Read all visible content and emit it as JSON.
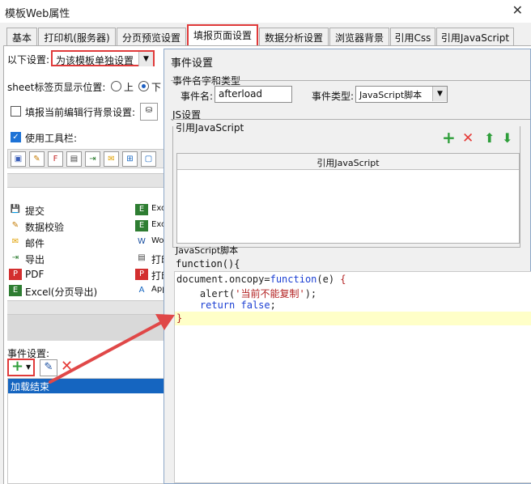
{
  "window": {
    "title": "模板Web属性",
    "close": "✕"
  },
  "tabs": [
    {
      "label": "基本"
    },
    {
      "label": "打印机(服务器)"
    },
    {
      "label": "分页预览设置"
    },
    {
      "label": "填报页面设置"
    },
    {
      "label": "数据分析设置"
    },
    {
      "label": "浏览器背景"
    },
    {
      "label": "引用Css"
    },
    {
      "label": "引用JavaScript"
    }
  ],
  "settings": {
    "mode_label": "以下设置:",
    "mode_value": "为该模板单独设置",
    "sheet_position_label": "sheet标签页显示位置:",
    "pos_top": "上",
    "pos_bottom": "下",
    "fill_bg_label": "填报当前编辑行背景设置:",
    "use_toolbar_label": "使用工具栏:"
  },
  "toolbar_list_left": [
    {
      "icon": "submit-icon",
      "label": "提交",
      "glyph": "💾"
    },
    {
      "icon": "verify-icon",
      "label": "数据校验",
      "glyph": "✎"
    },
    {
      "icon": "mail-icon",
      "label": "邮件",
      "glyph": "✉"
    },
    {
      "icon": "export-icon",
      "label": "导出",
      "glyph": "⇥"
    },
    {
      "icon": "pdf-icon",
      "label": "PDF",
      "glyph": "P"
    },
    {
      "icon": "excel-icon",
      "label": "Excel(分页导出)",
      "glyph": "E"
    }
  ],
  "toolbar_list_right": [
    {
      "icon": "excel-icon",
      "label": "Exc",
      "glyph": "E"
    },
    {
      "icon": "excel-icon",
      "label": "Exc",
      "glyph": "E"
    },
    {
      "icon": "word-icon",
      "label": "Wor",
      "glyph": "W"
    },
    {
      "icon": "print-icon",
      "label": "打印",
      "glyph": "▤"
    },
    {
      "icon": "print-icon",
      "label": "打印",
      "glyph": "P"
    },
    {
      "icon": "app-icon",
      "label": "App",
      "glyph": "A"
    }
  ],
  "events": {
    "label": "事件设置:",
    "items": [
      "加载结束"
    ]
  },
  "dialog": {
    "title": "事件设置",
    "name_type_group": "事件名字和类型",
    "event_name_label": "事件名:",
    "event_name_value": "afterload",
    "event_type_label": "事件类型:",
    "event_type_value": "JavaScript脚本",
    "js_group": "JS设置",
    "ref_js_group": "引用JavaScript",
    "ref_js_column": "引用JavaScript",
    "script_group": "JavaScript脚本",
    "func_header": "function(){",
    "code_lines": [
      {
        "parts": [
          [
            "fn",
            "document.oncopy="
          ],
          [
            "kw",
            "function"
          ],
          [
            "fn",
            "(e) "
          ],
          [
            "str",
            "{"
          ]
        ]
      },
      {
        "parts": [
          [
            "fn",
            "    alert("
          ],
          [
            "str",
            "'当前不能复制'"
          ],
          [
            "fn",
            ");"
          ]
        ]
      },
      {
        "parts": [
          [
            "fn",
            "    "
          ],
          [
            "kw",
            "return"
          ],
          [
            "fn",
            " "
          ],
          [
            "kw",
            "false"
          ],
          [
            "fn",
            ";"
          ]
        ]
      },
      {
        "parts": [
          [
            "str",
            "}"
          ]
        ]
      }
    ]
  },
  "colors": {
    "accent": "#1d72d6",
    "highlight_red": "#e03a3a",
    "selected_row": "#1565c0",
    "code_highlight": "#ffffc8"
  }
}
